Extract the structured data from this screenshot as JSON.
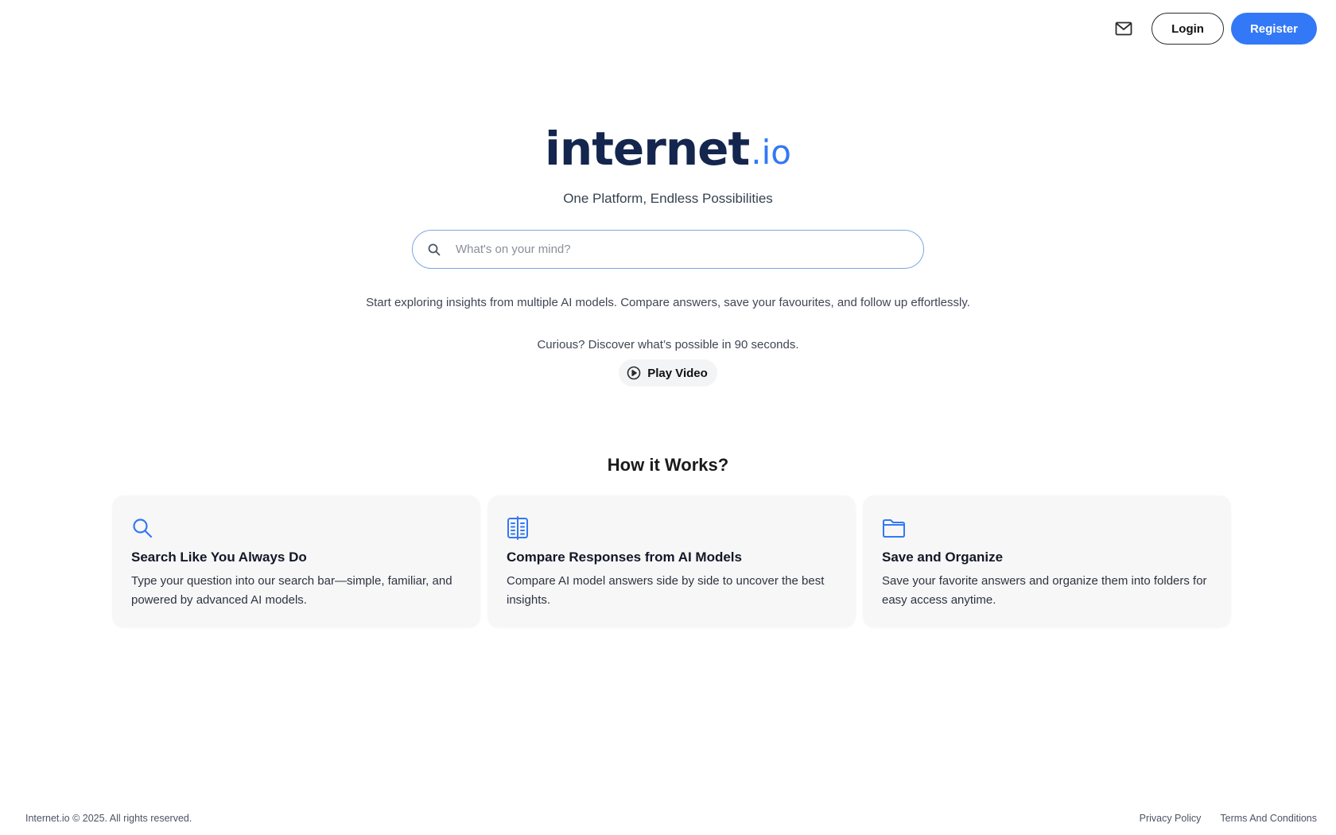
{
  "header": {
    "mail_icon": "mail-icon",
    "login_label": "Login",
    "register_label": "Register"
  },
  "hero": {
    "logo_main": "internet",
    "logo_tld": ".io",
    "tagline": "One Platform, Endless Possibilities",
    "search_placeholder": "What's on your mind?",
    "intro": "Start exploring insights from multiple AI models. Compare answers, save your favourites, and follow up effortlessly.",
    "curious": "Curious? Discover what’s possible in 90 seconds.",
    "play_label": "Play Video"
  },
  "how": {
    "title": "How it Works?",
    "cards": [
      {
        "icon": "search-icon",
        "title": "Search Like You Always Do",
        "desc": "Type your question into our search bar—simple, familiar, and powered by advanced AI models."
      },
      {
        "icon": "compare-icon",
        "title": "Compare Responses from AI Models",
        "desc": "Compare AI model answers side by side to uncover the best insights."
      },
      {
        "icon": "folder-icon",
        "title": "Save and Organize",
        "desc": "Save your favorite answers and organize them into folders for easy access anytime."
      }
    ]
  },
  "footer": {
    "copyright": "Internet.io © 2025. All rights reserved.",
    "privacy": "Privacy Policy",
    "terms": "Terms And Conditions"
  },
  "colors": {
    "accent": "#3378f6",
    "logo_navy": "#14264e",
    "card_bg": "#f7f7f7"
  }
}
